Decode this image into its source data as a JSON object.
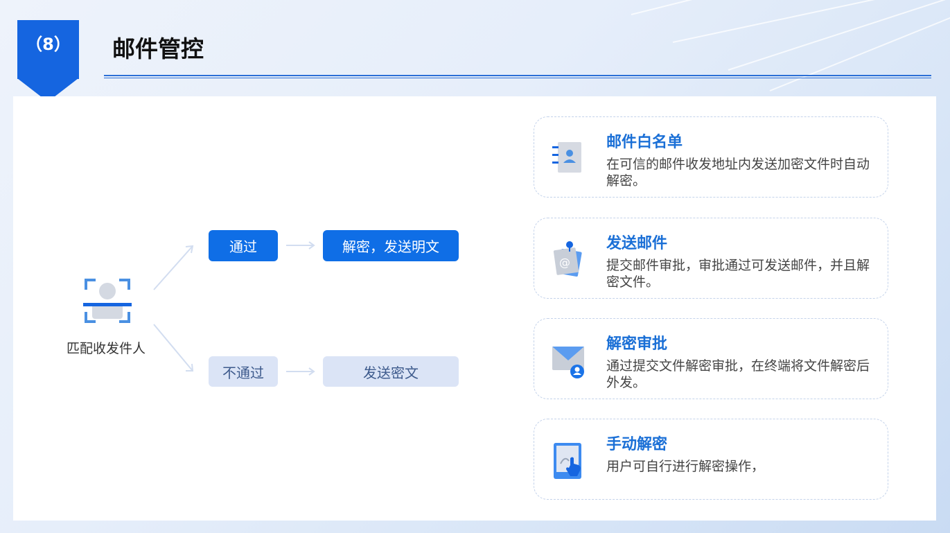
{
  "header": {
    "badge": "（8）",
    "title": "邮件管控"
  },
  "flow": {
    "source_label": "匹配收发件人",
    "pass_label": "通过",
    "pass_result": "解密，发送明文",
    "fail_label": "不通过",
    "fail_result": "发送密文"
  },
  "features": [
    {
      "icon": "contact-book-icon",
      "title": "邮件白名单",
      "desc": "在可信的邮件收发地址内发送加密文件时自动解密。"
    },
    {
      "icon": "pinned-mail-note-icon",
      "title": "发送邮件",
      "desc": "提交邮件审批，审批通过可发送邮件，并且解密文件。"
    },
    {
      "icon": "envelope-user-icon",
      "title": "解密审批",
      "desc": "通过提交文件解密审批，在终端将文件解密后外发。"
    },
    {
      "icon": "tablet-touch-icon",
      "title": "手动解密",
      "desc": "用户可自行进行解密操作，"
    }
  ],
  "colors": {
    "accent": "#1565e0",
    "primary_button": "#0f6ee6",
    "light_button": "#dbe4f6",
    "card_title": "#1a6fd6"
  }
}
